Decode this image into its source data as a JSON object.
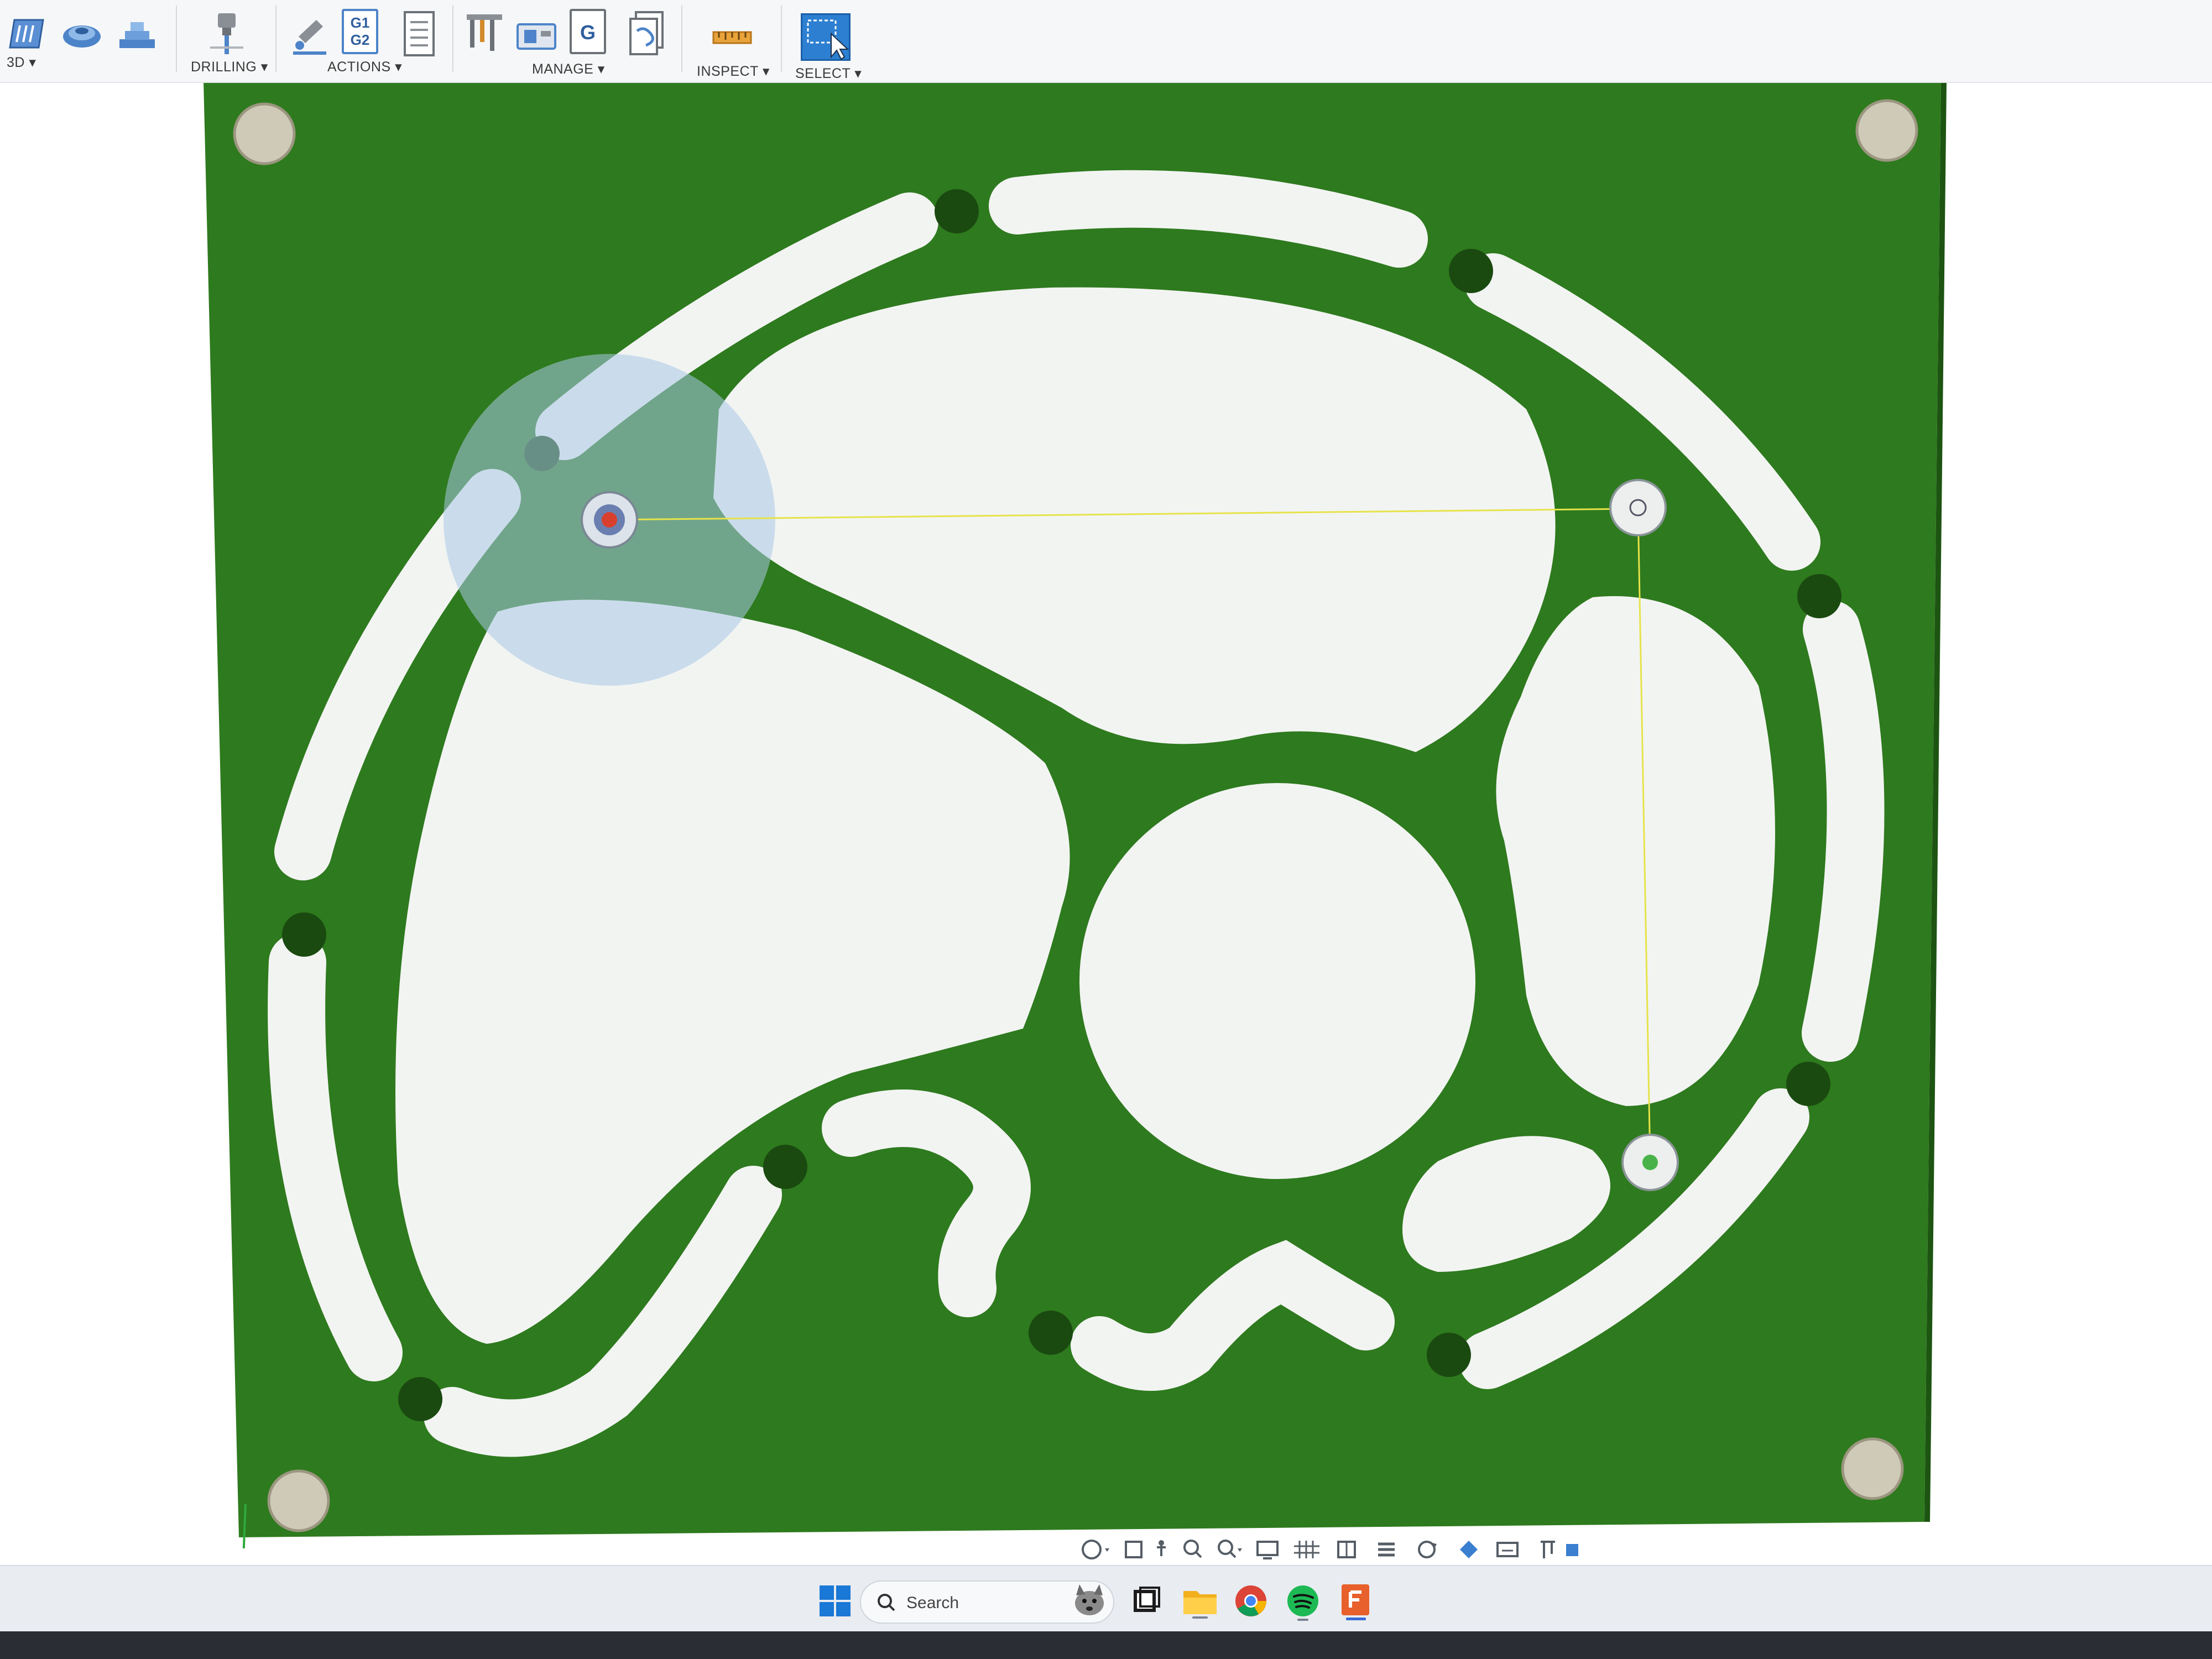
{
  "toolbar": {
    "groups": [
      {
        "label": "3D ▾"
      },
      {
        "label": "DRILLING ▾"
      },
      {
        "label": "ACTIONS ▾"
      },
      {
        "label": "MANAGE ▾"
      },
      {
        "label": "INSPECT ▾"
      },
      {
        "label": "SELECT ▾"
      }
    ],
    "actions_icon_text_top": "G1",
    "actions_icon_text_bottom": "G2",
    "manage_icon_text": "G"
  },
  "taskbar": {
    "search_placeholder": "Search",
    "apps": [
      "windows-start",
      "search",
      "dog-widget",
      "task-view",
      "file-explorer",
      "chrome",
      "spotify",
      "fusion-360"
    ]
  },
  "colors": {
    "stock": "#2e7a1e",
    "stock_dark": "#245f17",
    "cutout": "#f2f4f2",
    "corner_hole": "#cfcab8",
    "selection": "#2d7fd1"
  }
}
